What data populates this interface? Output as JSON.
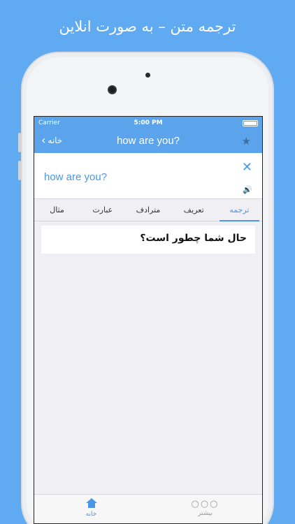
{
  "promo": {
    "headline": "ترجمه متن – به صورت انلاین"
  },
  "status_bar": {
    "carrier": "Carrier",
    "time": "5:00 PM"
  },
  "nav": {
    "back_label": "خانه",
    "title": "how are you?",
    "star_icon": "star-icon"
  },
  "input": {
    "text": "how are you?",
    "clear_icon": "close-icon",
    "speak_icon": "speaker-icon"
  },
  "tabs": [
    {
      "label": "ترجمه",
      "active": true
    },
    {
      "label": "تعریف",
      "active": false
    },
    {
      "label": "مترادف",
      "active": false
    },
    {
      "label": "عبارت",
      "active": false
    },
    {
      "label": "مثال",
      "active": false
    }
  ],
  "result": {
    "text": "حال شما چطور است؟"
  },
  "tab_bar": {
    "home_label": "خانه",
    "more_label": "بیشتر"
  },
  "colors": {
    "background": "#5faaf0",
    "nav": "#5ba4ec",
    "accent": "#4a97e8"
  }
}
